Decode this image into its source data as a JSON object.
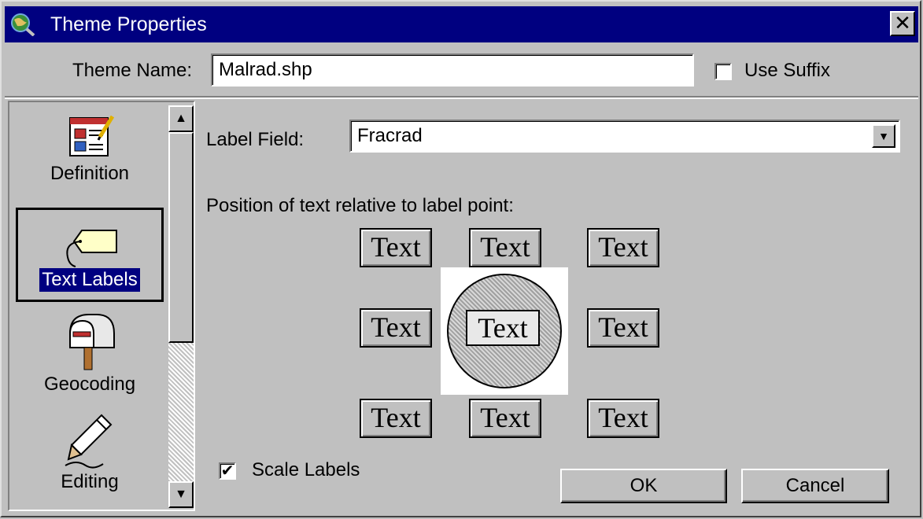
{
  "window": {
    "title": "Theme Properties",
    "close_glyph": "✕",
    "titlebar_color": "#000080"
  },
  "theme_name": {
    "label": "Theme Name:",
    "value": "Malrad.shp",
    "use_suffix_label": "Use Suffix",
    "use_suffix_checked": false
  },
  "categories": {
    "items": [
      {
        "label": "Definition",
        "icon": "definition-icon",
        "selected": false
      },
      {
        "label": "Text Labels",
        "icon": "tag-icon",
        "selected": true
      },
      {
        "label": "Geocoding",
        "icon": "mailbox-icon",
        "selected": false
      },
      {
        "label": "Editing",
        "icon": "pencil-icon",
        "selected": false
      }
    ],
    "scroll_up": "▲",
    "scroll_down": "▼"
  },
  "label_field": {
    "label": "Label Field:",
    "value": "Fracrad",
    "dropdown_glyph": "▼"
  },
  "position": {
    "label": "Position of text relative to label point:",
    "buttons": [
      {
        "id": "top-left",
        "text": "Text"
      },
      {
        "id": "top-center",
        "text": "Text"
      },
      {
        "id": "top-right",
        "text": "Text"
      },
      {
        "id": "middle-left",
        "text": "Text"
      },
      {
        "id": "middle-center",
        "text": "Text",
        "selected": true
      },
      {
        "id": "middle-right",
        "text": "Text"
      },
      {
        "id": "bottom-left",
        "text": "Text"
      },
      {
        "id": "bottom-center",
        "text": "Text"
      },
      {
        "id": "bottom-right",
        "text": "Text"
      }
    ]
  },
  "scale_labels": {
    "label": "Scale Labels",
    "checked": true,
    "check_glyph": "✔"
  },
  "actions": {
    "ok_label": "OK",
    "cancel_label": "Cancel"
  }
}
